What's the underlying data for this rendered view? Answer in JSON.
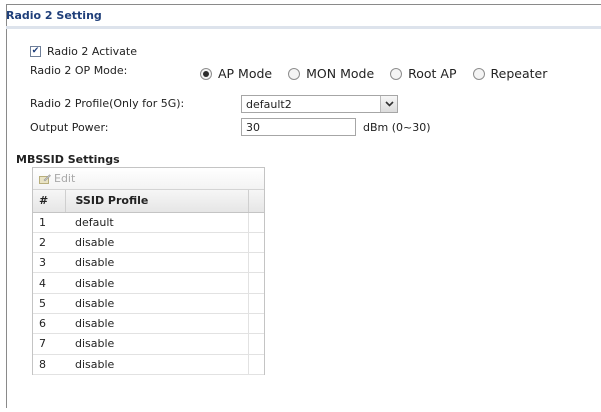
{
  "section": {
    "title": "Radio 2 Setting"
  },
  "activate": {
    "label": "Radio 2 Activate",
    "checked": true
  },
  "op_mode": {
    "label": "Radio 2 OP Mode:",
    "options": [
      "AP Mode",
      "MON Mode",
      "Root AP",
      "Repeater"
    ],
    "selected": "AP Mode"
  },
  "profile": {
    "label": "Radio 2 Profile(Only for 5G):",
    "value": "default2"
  },
  "power": {
    "label": "Output Power:",
    "value": "30",
    "unit": "dBm (0~30)"
  },
  "mbssid": {
    "title": "MBSSID Settings",
    "edit_label": "Edit",
    "columns": [
      "#",
      "SSID Profile"
    ],
    "rows": [
      [
        "1",
        "default"
      ],
      [
        "2",
        "disable"
      ],
      [
        "3",
        "disable"
      ],
      [
        "4",
        "disable"
      ],
      [
        "5",
        "disable"
      ],
      [
        "6",
        "disable"
      ],
      [
        "7",
        "disable"
      ],
      [
        "8",
        "disable"
      ]
    ]
  },
  "colors": {
    "title": "#1f3f7a",
    "border": "#8a8a8a"
  }
}
